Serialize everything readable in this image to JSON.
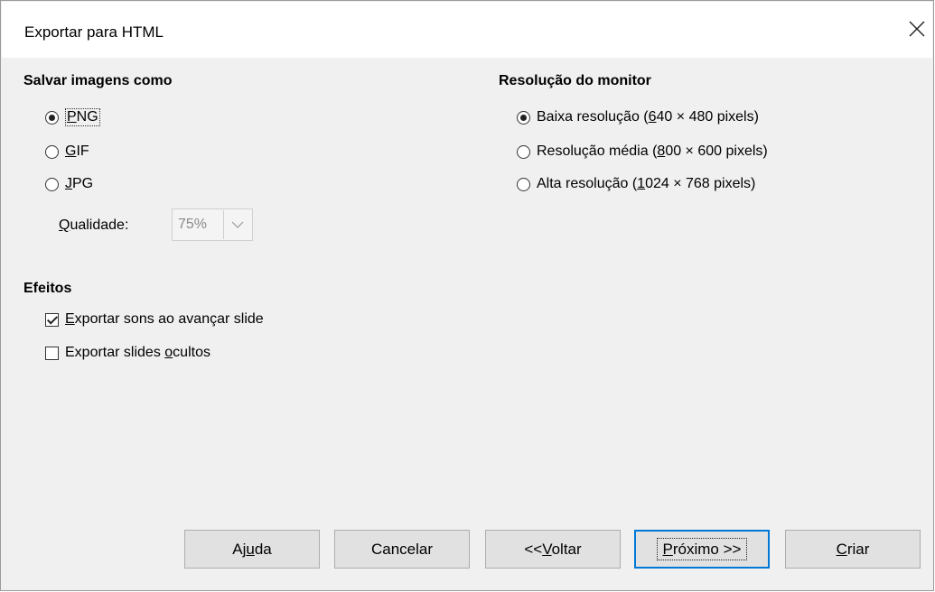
{
  "window": {
    "title": "Exportar para HTML"
  },
  "images": {
    "heading": "Salvar imagens como",
    "options": [
      {
        "pre": "",
        "key": "P",
        "post": "NG",
        "checked": true
      },
      {
        "pre": "",
        "key": "G",
        "post": "IF",
        "checked": false
      },
      {
        "pre": "",
        "key": "J",
        "post": "PG",
        "checked": false
      }
    ],
    "quality_label_key": "Q",
    "quality_label_rest": "ualidade:",
    "quality_value": "75%"
  },
  "resolution": {
    "heading": "Resolução do monitor",
    "options": [
      {
        "pre": "Baixa resolução (",
        "key": "6",
        "post": "40 × 480 pixels)",
        "checked": true
      },
      {
        "pre": "Resolução média (",
        "key": "8",
        "post": "00 × 600 pixels)",
        "checked": false
      },
      {
        "pre": "Alta resolução (",
        "key": "1",
        "post": "024 × 768 pixels)",
        "checked": false
      }
    ]
  },
  "effects": {
    "heading": "Efeitos",
    "options": [
      {
        "pre": "",
        "key": "E",
        "post": "xportar sons ao avançar slide",
        "checked": true
      },
      {
        "pre": "Exportar slides ",
        "key": "o",
        "post": "cultos",
        "checked": false
      }
    ]
  },
  "buttons": {
    "help": {
      "pre": "Aj",
      "key": "u",
      "post": "da"
    },
    "cancel": "Cancelar",
    "back": {
      "pre": "<<",
      "key": "V",
      "post": "oltar"
    },
    "next": {
      "pre": "",
      "key": "P",
      "post": "róximo >>"
    },
    "create": {
      "pre": "",
      "key": "C",
      "post": "riar"
    }
  },
  "colors": {
    "default_button_border": "#0078d7",
    "dialog_bg": "#f0f0f0"
  }
}
